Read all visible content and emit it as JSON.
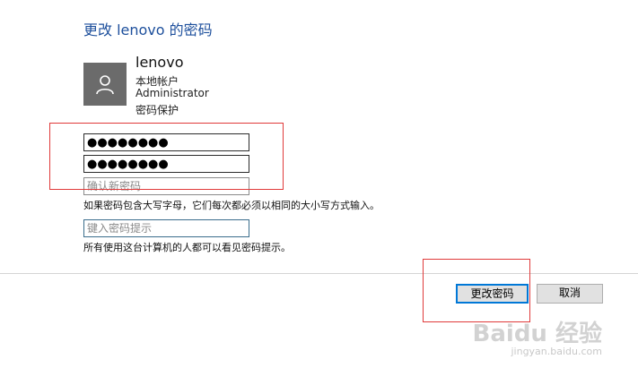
{
  "dialog": {
    "title": "更改 lenovo 的密码",
    "user": {
      "name": "lenovo",
      "account_type": "本地帐户",
      "role": "Administrator",
      "protection": "密码保护"
    },
    "fields": {
      "current_password_value": "●●●●●●●●",
      "new_password_value": "●●●●●●●●",
      "confirm_placeholder": "确认新密码",
      "hint_placeholder": "键入密码提示"
    },
    "help_text_case": "如果密码包含大写字母，它们每次都必须以相同的大小写方式输入。",
    "help_text_hint": "所有使用这台计算机的人都可以看见密码提示。",
    "buttons": {
      "change_password": "更改密码",
      "cancel": "取消"
    }
  },
  "watermark": {
    "logo": "Baidu 经验",
    "url": "jingyan.baidu.com"
  },
  "colors": {
    "title": "#1d4f9c",
    "avatar_bg": "#6b6b6b",
    "primary_border": "#0078d7",
    "highlight_box": "#e03a3a"
  }
}
